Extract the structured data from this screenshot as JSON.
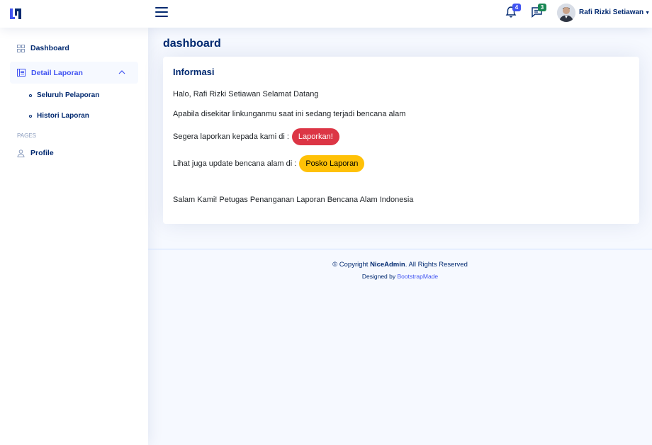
{
  "header": {
    "user_name": "Rafi Rizki Setiawan",
    "notifications_count": "4",
    "messages_count": "3"
  },
  "sidebar": {
    "dashboard_label": "Dashboard",
    "detail_label": "Detail Laporan",
    "sub_items": [
      "Seluruh Pelaporan",
      "Histori Laporan"
    ],
    "pages_heading": "PAGES",
    "profile_label": "Profile"
  },
  "main": {
    "page_title": "dashboard",
    "card": {
      "title": "Informasi",
      "greeting": "Halo, Rafi Rizki Setiawan Selamat Datang",
      "line2": "Apabila disekitar linkunganmu saat ini sedang terjadi bencana alam",
      "line3": "Segera laporkan kepada kami di :",
      "report_button": "Laporkan!",
      "line4": "Lihat juga update bencana alam di :",
      "posko_button": "Posko Laporan",
      "closing": "Salam Kami! Petugas Penanganan Laporan Bencana Alam Indonesia"
    }
  },
  "footer": {
    "copyright_prefix": "© Copyright ",
    "brand": "NiceAdmin",
    "copyright_suffix": ". All Rights Reserved",
    "designed_by": "Designed by ",
    "designer": "BootstrapMade"
  },
  "colors": {
    "primary": "#4154f1",
    "navy": "#012970",
    "danger": "#dc3545",
    "warning": "#ffc107"
  }
}
